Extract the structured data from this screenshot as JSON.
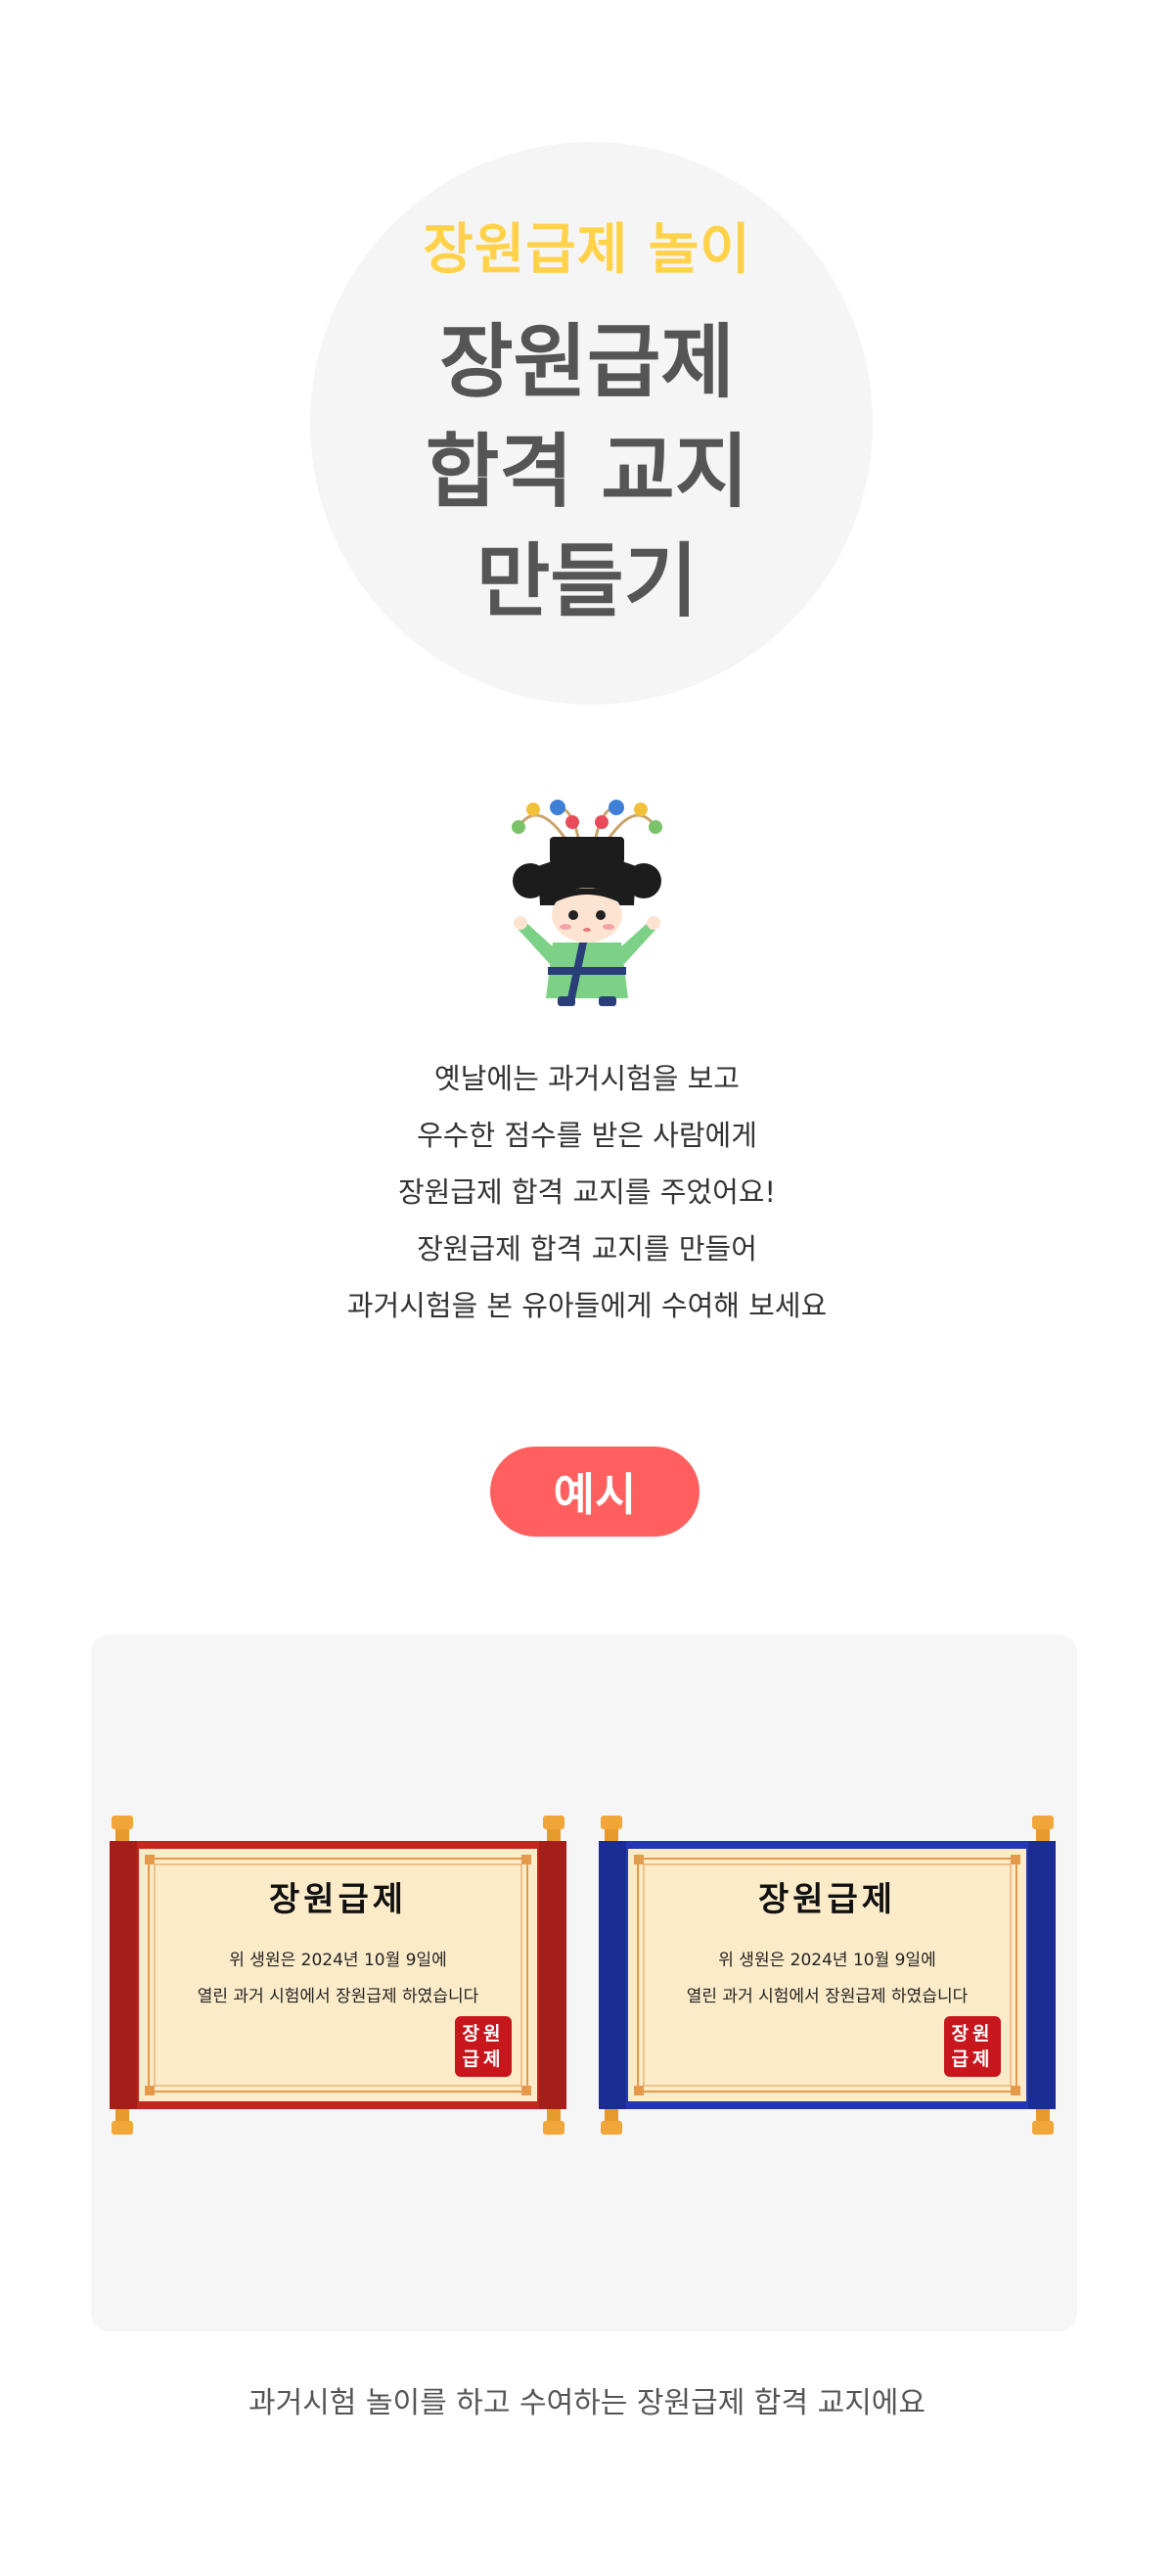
{
  "hero": {
    "subtitle": "장원급제 놀이",
    "title_lines": [
      "장원급제",
      "합격 교지",
      "만들기"
    ]
  },
  "intro": {
    "lines": [
      "옛날에는 과거시험을 보고",
      "우수한 점수를 받은 사람에게",
      "장원급제 합격 교지를 주었어요!",
      "장원급제 합격 교지를 만들어",
      "과거시험을 본 유아들에게 수여해 보세요"
    ]
  },
  "example": {
    "label": "예시",
    "certificates": [
      {
        "theme": "red",
        "frame_color": "#c0271f",
        "title": "장원급제",
        "line1": "위 생원은 2024년 10월 9일에",
        "line2": "열린 과거 시험에서 장원급제 하였습니다",
        "seal_top": "장원",
        "seal_bottom": "급제"
      },
      {
        "theme": "blue",
        "frame_color": "#2338b0",
        "title": "장원급제",
        "line1": "위 생원은 2024년 10월 9일에",
        "line2": "열린 과거 시험에서 장원급제 하였습니다",
        "seal_top": "장원",
        "seal_bottom": "급제"
      }
    ],
    "caption": "과거시험 놀이를 하고 수여하는 장원급제 합격 교지에요"
  },
  "colors": {
    "hero_subtitle": "#ffd24a",
    "hero_title": "#555555",
    "pill": "#ff5f5f",
    "paper": "#fbebc9",
    "seal": "#c8161d"
  }
}
